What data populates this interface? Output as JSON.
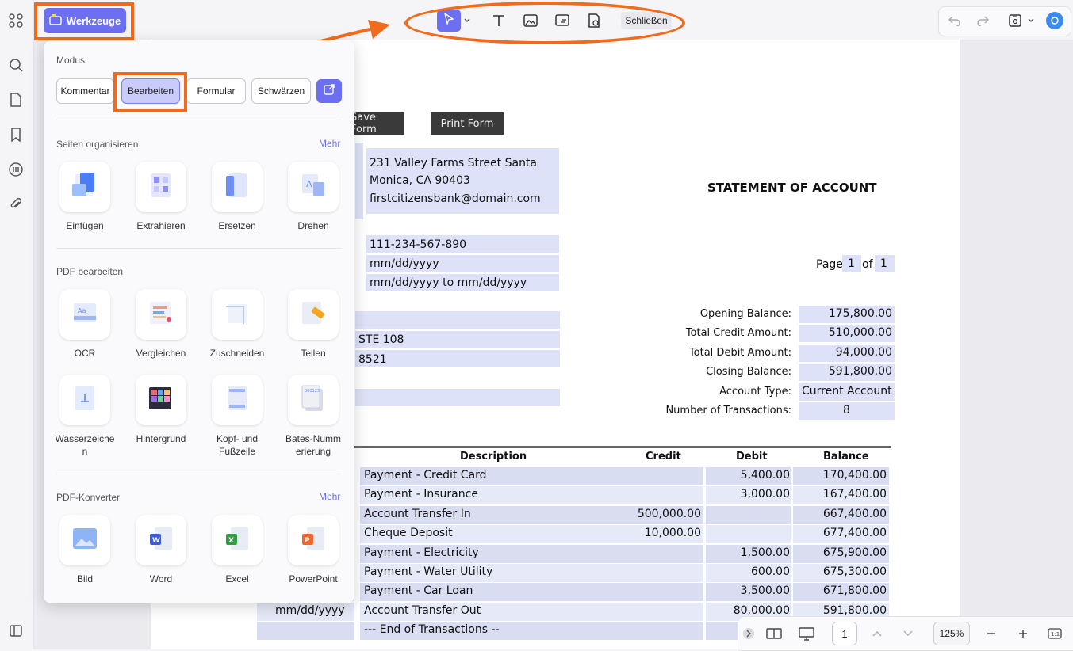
{
  "toolbar": {
    "tools_label": "Werkzeuge",
    "close_label": "Schließen"
  },
  "panel": {
    "mode_title": "Modus",
    "modes": [
      "Kommentar",
      "Bearbeiten",
      "Formular",
      "Schwärzen"
    ],
    "active_mode": "Bearbeiten",
    "organize": {
      "title": "Seiten organisieren",
      "more": "Mehr",
      "items": [
        "Einfügen",
        "Extrahieren",
        "Ersetzen",
        "Drehen"
      ]
    },
    "edit": {
      "title": "PDF bearbeiten",
      "items": [
        "OCR",
        "Vergleichen",
        "Zuschneiden",
        "Teilen",
        "Wasserzeichen",
        "Hintergrund",
        "Kopf- und Fußzeile",
        "Bates-Nummerierung"
      ],
      "labels_display": [
        "OCR",
        "Vergleichen",
        "Zuschneiden",
        "Teilen",
        "Wasserzeiche\nn",
        "Hintergrund",
        "Kopf- und\nFußzeile",
        "Bates-Numm\nerierung"
      ]
    },
    "converter": {
      "title": "PDF-Konverter",
      "more": "Mehr",
      "items": [
        "Bild",
        "Word",
        "Excel",
        "PowerPoint"
      ]
    }
  },
  "document": {
    "save_form": "Save Form",
    "print_form": "Print Form",
    "address_line1": "231 Valley Farms Street Santa",
    "address_line2": "Monica, CA 90403",
    "email": "firstcitizensbank@domain.com",
    "title": "STATEMENT OF ACCOUNT",
    "account_number": "111-234-567-890",
    "date": "mm/dd/yyyy",
    "period": "mm/dd/yyyy to mm/dd/yyyy",
    "page_label": "Page",
    "page_num": "1",
    "of_label": "of",
    "page_total": "1",
    "addr_partial1": "STE 108",
    "addr_partial2": "8521",
    "summary": [
      {
        "label": "Opening Balance:",
        "value": "175,800.00"
      },
      {
        "label": "Total Credit Amount:",
        "value": "510,000.00"
      },
      {
        "label": "Total Debit Amount:",
        "value": "94,000.00"
      },
      {
        "label": "Closing Balance:",
        "value": "591,800.00"
      },
      {
        "label": "Account Type:",
        "value": "Current Account"
      },
      {
        "label": "Number of Transactions:",
        "value": "8"
      }
    ],
    "table_headers": [
      "Description",
      "Credit",
      "Debit",
      "Balance"
    ],
    "rows": [
      {
        "date": "",
        "desc": "Payment - Credit Card",
        "credit": "",
        "debit": "5,400.00",
        "balance": "170,400.00"
      },
      {
        "date": "",
        "desc": "Payment - Insurance",
        "credit": "",
        "debit": "3,000.00",
        "balance": "167,400.00"
      },
      {
        "date": "",
        "desc": "Account Transfer In",
        "credit": "500,000.00",
        "debit": "",
        "balance": "667,400.00"
      },
      {
        "date": "",
        "desc": "Cheque Deposit",
        "credit": "10,000.00",
        "debit": "",
        "balance": "677,400.00"
      },
      {
        "date": "",
        "desc": "Payment - Electricity",
        "credit": "",
        "debit": "1,500.00",
        "balance": "675,900.00"
      },
      {
        "date": "",
        "desc": "Payment - Water Utility",
        "credit": "",
        "debit": "600.00",
        "balance": "675,300.00"
      },
      {
        "date": "",
        "desc": "Payment - Car Loan",
        "credit": "",
        "debit": "3,500.00",
        "balance": "671,800.00"
      },
      {
        "date": "mm/dd/yyyy",
        "desc": "Account Transfer Out",
        "credit": "",
        "debit": "80,000.00",
        "balance": "591,800.00"
      },
      {
        "date": "",
        "desc": "--- End of Transactions --",
        "credit": "",
        "debit": "",
        "balance": ""
      }
    ]
  },
  "bottombar": {
    "page_input": "1",
    "zoom": "125%"
  },
  "colors": {
    "accent": "#6b6ff0",
    "annotation": "#f26b1d",
    "field_fill": "#dde2f8"
  }
}
